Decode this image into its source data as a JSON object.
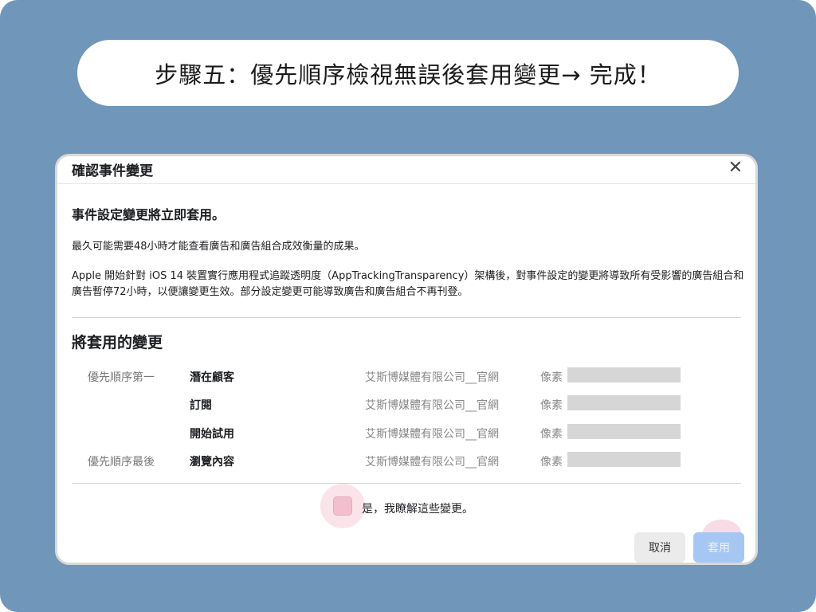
{
  "banner": {
    "text": "步驟五：優先順序檢視無誤後套用變更→ 完成！"
  },
  "dialog": {
    "title": "確認事件變更",
    "close_glyph": "✕",
    "heading": "事件設定變更將立即套用。",
    "paragraph1": "最久可能需要48小時才能查看廣告和廣告組合成效衡量的成果。",
    "paragraph2": "Apple 開始針對 iOS 14 裝置實行應用程式追蹤透明度（AppTrackingTransparency）架構後，對事件設定的變更將導致所有受影響的廣告組合和廣告暫停72小時，以便讓變更生效。部分設定變更可能導致廣告和廣告組合不再刊登。",
    "changes_heading": "將套用的變更",
    "rows": [
      {
        "priority": "優先順序第一",
        "event": "潛在顧客",
        "company": "艾斯博媒體有限公司__官網",
        "pixel_label": "像素"
      },
      {
        "priority": "",
        "event": "訂閱",
        "company": "艾斯博媒體有限公司__官網",
        "pixel_label": "像素"
      },
      {
        "priority": "",
        "event": "開始試用",
        "company": "艾斯博媒體有限公司__官網",
        "pixel_label": "像素"
      },
      {
        "priority": "優先順序最後",
        "event": "瀏覽內容",
        "company": "艾斯博媒體有限公司__官網",
        "pixel_label": "像素"
      }
    ],
    "acknowledge_label": "是，我瞭解這些變更。",
    "cancel_label": "取消",
    "apply_label": "套用"
  },
  "colors": {
    "frame_bg": "#7096ba",
    "apply_button": "#a6c7f3",
    "checkbox_highlight": "#f3bfcf"
  }
}
